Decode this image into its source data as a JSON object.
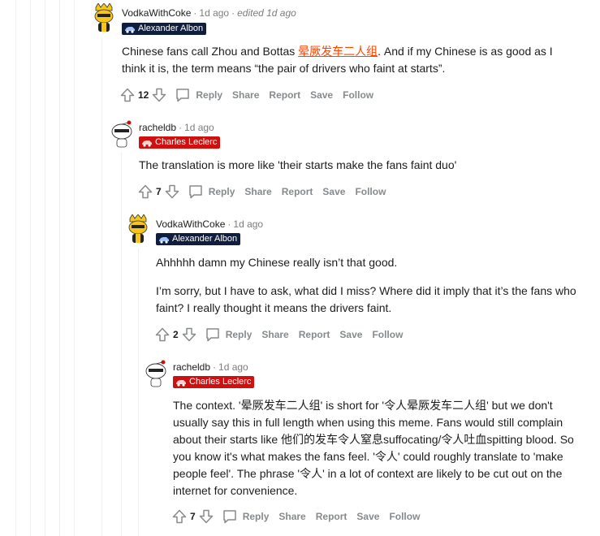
{
  "comments": [
    {
      "author": "VodkaWithCoke",
      "time": "1d ago",
      "edited": "edited 1d ago",
      "flair": "Alexander Albon",
      "text_before": "Chinese fans call Zhou and Bottas ",
      "link": "晕厥发车二人组",
      "text_after": ". And if my Chinese is as good as I think it is, the term means “the pair of drivers who faint at starts”.",
      "score": "12"
    },
    {
      "author": "racheldb",
      "time": "1d ago",
      "flair": "Charles Leclerc",
      "text": "The translation is more like 'their starts make the fans faint duo'",
      "score": "7"
    },
    {
      "author": "VodkaWithCoke",
      "time": "1d ago",
      "flair": "Alexander Albon",
      "paragraph_1": "Ahhhhh damn my Chinese really isn’t that good.",
      "paragraph_2": "I’m sorry, but I have to ask, what did I miss? Where did it imply that it’s the fans who faint? I really thought it means the drivers faint.",
      "score": "2"
    },
    {
      "author": "racheldb",
      "time": "1d ago",
      "flair": "Charles Leclerc",
      "text": "The context. '晕厥发车二人组' is short for '令人晕厥发车二人组' but we don't usually say this in full length when using this meme. Fans would still complain about their starts like 他们的发车令人窒息suffocating/令人吐血spitting blood. So you know it's what makes the fans feel. '令人' could roughly translate to 'make people feel'. The phrase '令人' in a lot of context are likely to be cut out on the internet for convenience.",
      "score": "7"
    }
  ],
  "actions": {
    "reply": "Reply",
    "share": "Share",
    "report": "Report",
    "save": "Save",
    "follow": "Follow"
  },
  "colors": {
    "flair_blue": "#0f1e3d",
    "flair_red": "#d00f0f",
    "link": "#ff4500",
    "muted": "#878a8c"
  }
}
